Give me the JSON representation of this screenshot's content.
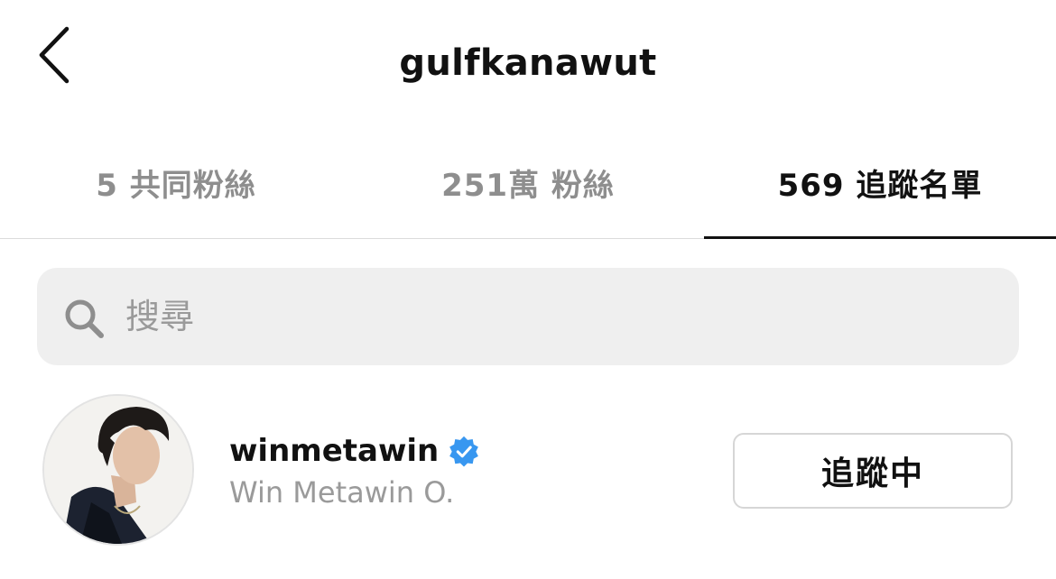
{
  "header": {
    "title": "gulfkanawut",
    "back_icon": "chevron-left-icon"
  },
  "tabs": [
    {
      "label": "5 共同粉絲",
      "active": false
    },
    {
      "label": "251萬 粉絲",
      "active": false
    },
    {
      "label": "569 追蹤名單",
      "active": true
    }
  ],
  "search": {
    "placeholder": "搜尋",
    "value": "",
    "icon": "search-icon"
  },
  "list": [
    {
      "username": "winmetawin",
      "full_name": "Win Metawin O.",
      "verified": true,
      "follow_label": "追蹤中"
    }
  ],
  "colors": {
    "verified_badge": "#3897f0",
    "inactive_tab": "#8e8e8e",
    "active_tab": "#111111",
    "search_bg": "#efefef"
  }
}
